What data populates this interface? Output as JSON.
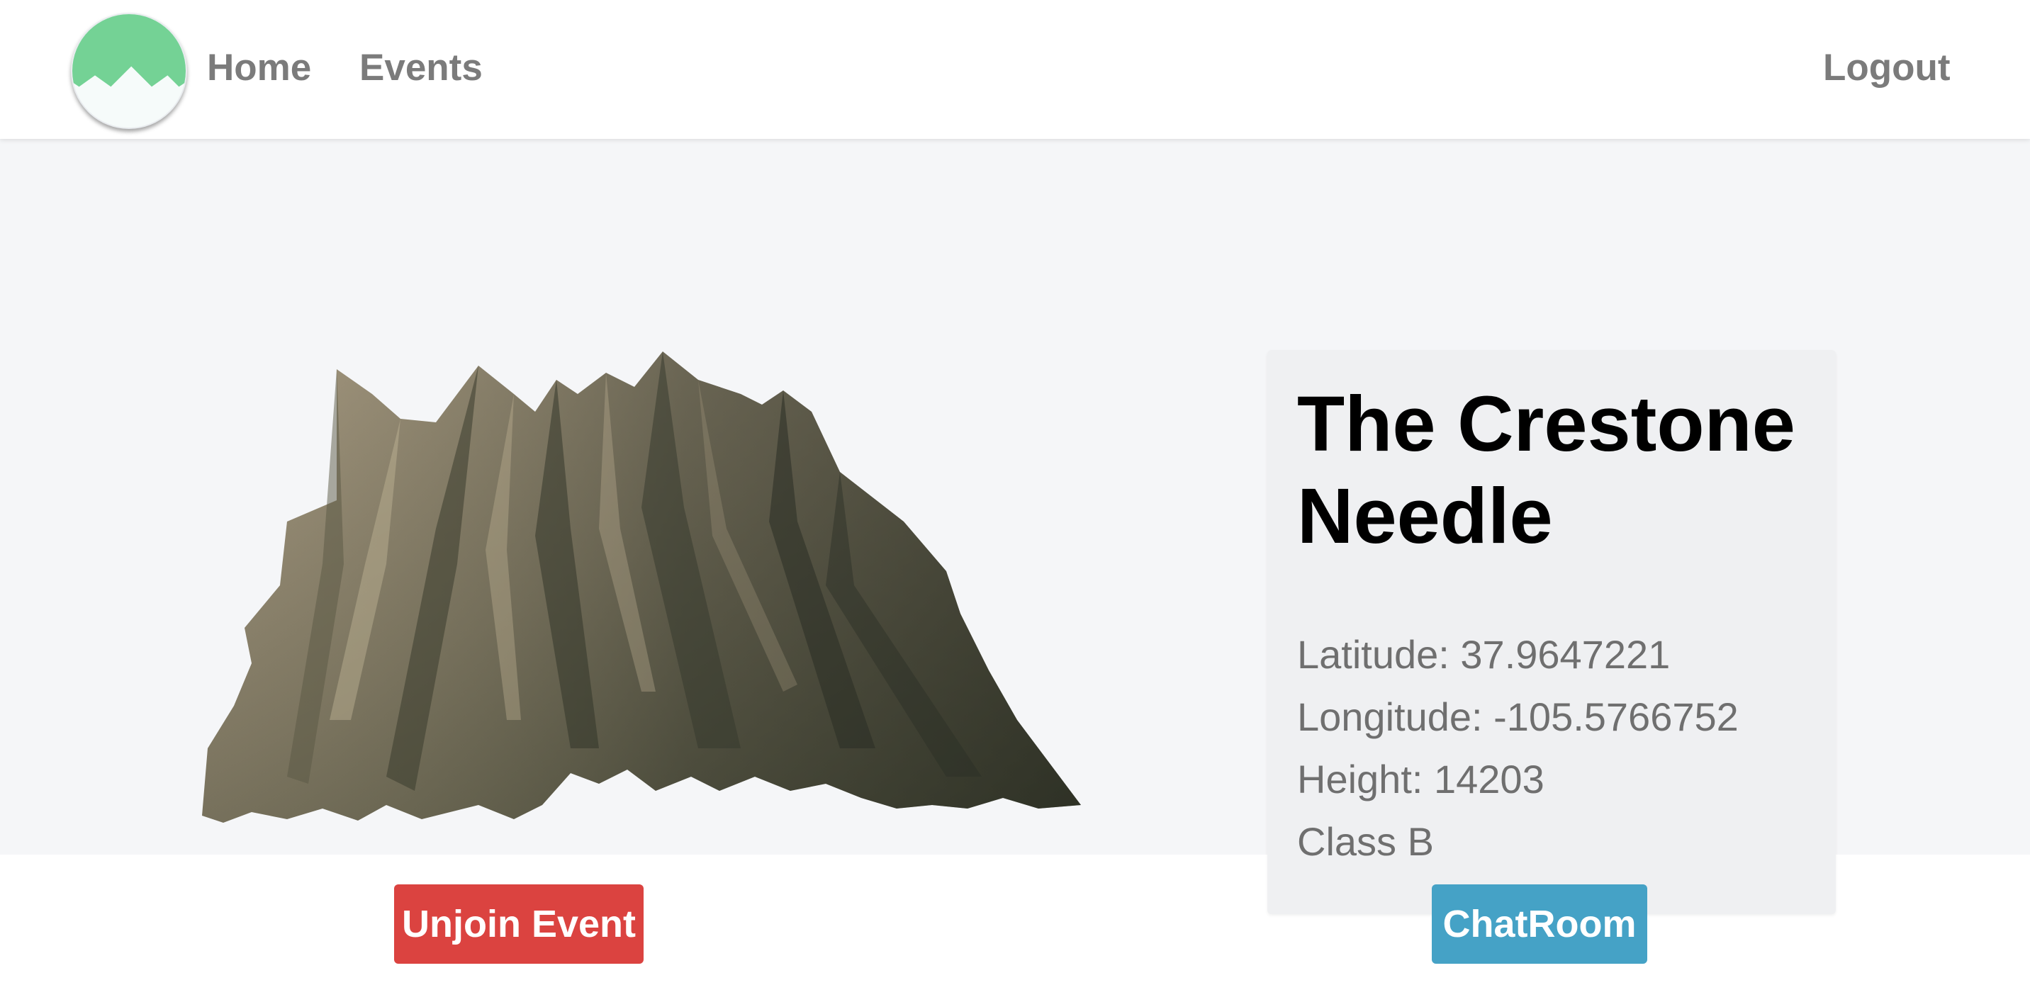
{
  "nav": {
    "logo_icon": "mountain-logo-icon",
    "home_label": "Home",
    "events_label": "Events",
    "logout_label": "Logout"
  },
  "peak": {
    "name": "The Crestone Needle",
    "latitude_text": "Latitude: 37.9647221",
    "longitude_text": "Longitude: -105.5766752",
    "height_text": "Height: 14203",
    "class_text": "Class B"
  },
  "actions": {
    "unjoin_label": "Unjoin Event",
    "chatroom_label": "ChatRoom"
  },
  "colors": {
    "logo_green": "#74d295",
    "unjoin_button": "#db4340",
    "chatroom_button": "#45a2c6",
    "hero_background": "#f5f6f8",
    "card_background": "#eff0f2"
  }
}
